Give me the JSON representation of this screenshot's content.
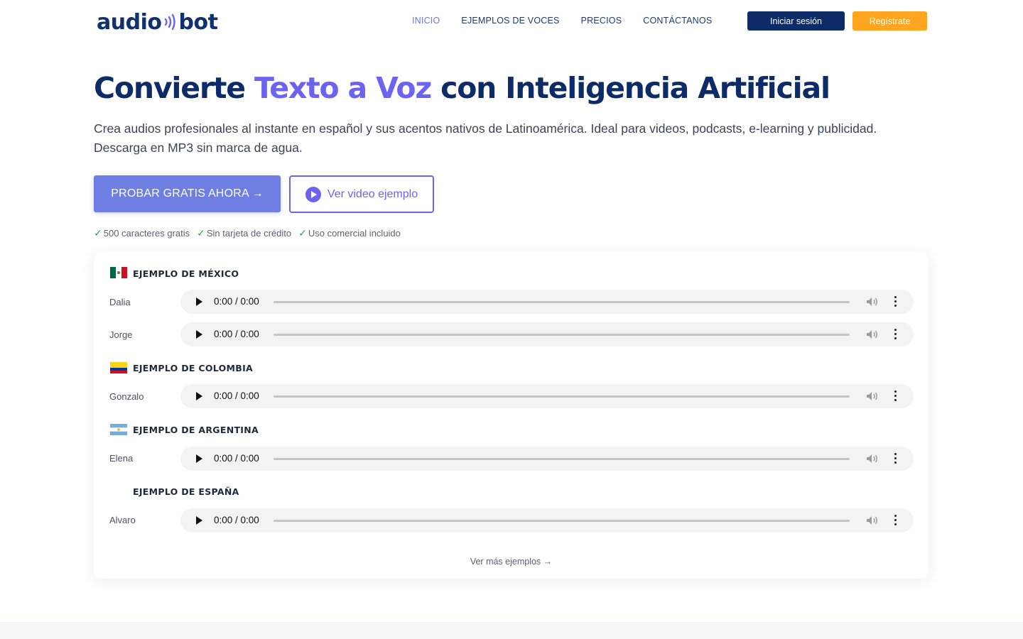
{
  "header": {
    "logo_left": "audio",
    "logo_right": "bot",
    "nav": [
      {
        "label": "INICIO",
        "active": true
      },
      {
        "label": "EJEMPLOS DE VOCES",
        "active": false
      },
      {
        "label": "PRECIOS",
        "active": false
      },
      {
        "label": "CONTÁCTANOS",
        "active": false
      }
    ],
    "login_label": "Iniciar sesión",
    "signup_label": "Regístrate"
  },
  "hero": {
    "title_part1": "Convierte ",
    "title_accent": "Texto a Voz",
    "title_part2": " con Inteligencia Artificial",
    "description": "Crea audios profesionales al instante en español y sus acentos nativos de Latinoamérica. Ideal para videos, podcasts, e-learning y publicidad. Descarga en MP3 sin marca de agua.",
    "cta_primary": "PROBAR GRATIS AHORA →",
    "cta_secondary": "Ver video ejemplo",
    "perks": [
      "500 caracteres gratis",
      "Sin tarjeta de crédito",
      "Uso comercial incluido"
    ]
  },
  "samples": {
    "groups": [
      {
        "title": "EJEMPLO DE MÉXICO",
        "flag": "mexico-flag-icon",
        "voices": [
          "Dalia",
          "Jorge"
        ]
      },
      {
        "title": "EJEMPLO DE COLOMBIA",
        "flag": "colombia-flag-icon",
        "voices": [
          "Gonzalo"
        ]
      },
      {
        "title": "EJEMPLO DE ARGENTINA",
        "flag": "argentina-flag-icon",
        "voices": [
          "Elena"
        ]
      },
      {
        "title": "EJEMPLO DE ESPAÑA",
        "flag": "",
        "voices": [
          "Alvaro"
        ]
      }
    ],
    "player_time": "0:00 / 0:00",
    "more_label": "Ver más ejemplos →"
  },
  "colors": {
    "navy": "#0d2b66",
    "accent_purple": "#6c63f0",
    "primary_button": "#6e7ee3",
    "signup_orange": "#ffa51f",
    "check_green": "#2aa84a"
  }
}
